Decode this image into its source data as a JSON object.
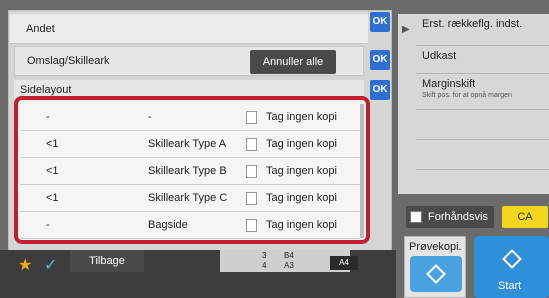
{
  "header": {
    "title": "Andet",
    "ok": "OK"
  },
  "section_cover": {
    "label": "Omslag/Skilleark",
    "ok": "OK",
    "cancel_all": "Annuller alle"
  },
  "section_page_layout": {
    "label": "Sidelayout",
    "ok": "OK"
  },
  "list": [
    {
      "col1": "-",
      "col2": "-",
      "col3": "Tag ingen kopi"
    },
    {
      "col1": "<1",
      "col2": "Skilleark Type A",
      "col3": "Tag ingen kopi"
    },
    {
      "col1": "<1",
      "col2": "Skilleark Type B",
      "col3": "Tag ingen kopi"
    },
    {
      "col1": "<1",
      "col2": "Skilleark Type C",
      "col3": "Tag ingen kopi"
    },
    {
      "col1": "-",
      "col2": "Bagside",
      "col3": "Tag ingen kopi"
    }
  ],
  "bottom": {
    "back": "Tilbage",
    "paper_sizes": [
      "B4",
      "A3"
    ],
    "paper_counts": [
      "3",
      "4"
    ],
    "paper_current": "A4"
  },
  "right": {
    "items": [
      {
        "title": "Erst. rækkeflg. indst."
      },
      {
        "title": "Udkast"
      },
      {
        "title": "Marginskift",
        "subtitle": "Skift pos. for at opnå margen"
      }
    ],
    "preview": "Forhåndsvis",
    "ca": "CA",
    "proof_copy": "Prøvekopi.",
    "start": "Start"
  },
  "colors": {
    "ok_blue": "#2f6fd1",
    "highlight_red": "#c01f2f",
    "start_blue": "#2f8fd8",
    "ca_yellow": "#f2d51c"
  }
}
